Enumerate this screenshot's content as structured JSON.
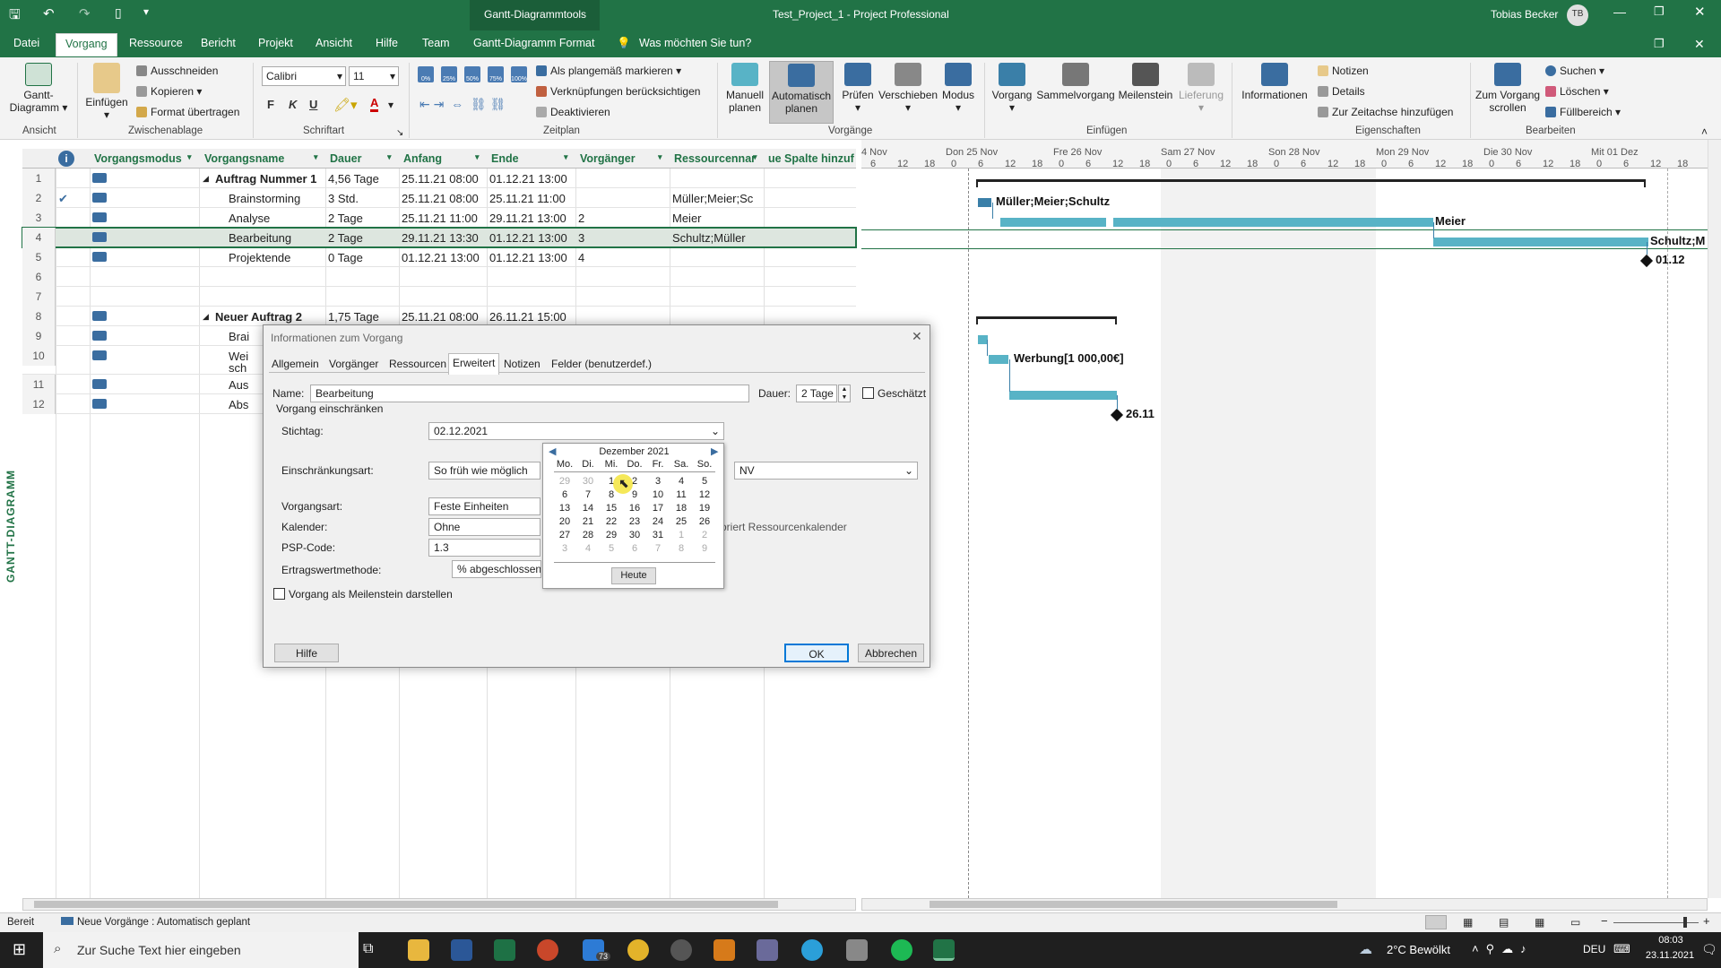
{
  "window": {
    "context_tab": "Gantt-Diagrammtools",
    "title": "Test_Project_1  -  Project Professional",
    "user": "Tobias Becker",
    "user_initials": "TB"
  },
  "menu": [
    "Datei",
    "Vorgang",
    "Ressource",
    "Bericht",
    "Projekt",
    "Ansicht",
    "Hilfe",
    "Team",
    "Gantt-Diagramm Format"
  ],
  "menu_active": "Vorgang",
  "tell_me": "Was möchten Sie tun?",
  "ribbon": {
    "ansicht": {
      "btn": "Gantt-",
      "btn2": "Diagramm",
      "label": "Ansicht"
    },
    "zwischenablage": {
      "paste": "Einfügen",
      "cut": "Ausschneiden",
      "copy": "Kopieren",
      "format": "Format übertragen",
      "label": "Zwischenablage"
    },
    "schrift": {
      "font": "Calibri",
      "size": "11",
      "bold": "F",
      "italic": "K",
      "underline": "U",
      "label": "Schriftart"
    },
    "zeitplan": {
      "mark": "Als plangemäß markieren",
      "links": "Verknüpfungen berücksichtigen",
      "deact": "Deaktivieren",
      "pct": [
        "0%",
        "25%",
        "50%",
        "75%",
        "100%"
      ],
      "label": "Zeitplan"
    },
    "vorgaenge": {
      "manual1": "Manuell",
      "manual2": "planen",
      "auto1": "Automatisch",
      "auto2": "planen",
      "check": "Prüfen",
      "move": "Verschieben",
      "mode": "Modus",
      "label": "Vorgänge"
    },
    "einfuegen": {
      "task": "Vorgang",
      "summary": "Sammelvorgang",
      "milestone": "Meilenstein",
      "delivery": "Lieferung",
      "label": "Einfügen"
    },
    "eigenschaften": {
      "info": "Informationen",
      "notes": "Notizen",
      "details": "Details",
      "timeline": "Zur Zeitachse hinzufügen",
      "label": "Eigenschaften"
    },
    "bearbeiten": {
      "scroll1": "Zum Vorgang",
      "scroll2": "scrollen",
      "search": "Suchen",
      "delete": "Löschen",
      "fill": "Füllbereich",
      "label": "Bearbeiten"
    }
  },
  "columns": [
    "Vorgangsmodus",
    "Vorgangsname",
    "Dauer",
    "Anfang",
    "Ende",
    "Vorgänger",
    "Ressourcennar",
    "ue Spalte hinzufü"
  ],
  "rows": [
    {
      "id": "1",
      "check": "",
      "name": "Auftrag Nummer 1",
      "dur": "4,56 Tage",
      "start": "25.11.21 08:00",
      "end": "01.12.21 13:00",
      "pred": "",
      "res": "",
      "summary": true,
      "mode": true
    },
    {
      "id": "2",
      "check": "✔",
      "name": "Brainstorming",
      "dur": "3 Std.",
      "start": "25.11.21 08:00",
      "end": "25.11.21 11:00",
      "pred": "",
      "res": "Müller;Meier;Sc",
      "summary": false,
      "mode": true
    },
    {
      "id": "3",
      "check": "",
      "name": "Analyse",
      "dur": "2 Tage",
      "start": "25.11.21 11:00",
      "end": "29.11.21 13:00",
      "pred": "2",
      "res": "Meier",
      "summary": false,
      "mode": true
    },
    {
      "id": "4",
      "check": "",
      "name": "Bearbeitung",
      "dur": "2 Tage",
      "start": "29.11.21 13:30",
      "end": "01.12.21 13:00",
      "pred": "3",
      "res": "Schultz;Müller",
      "summary": false,
      "mode": true
    },
    {
      "id": "5",
      "check": "",
      "name": "Projektende",
      "dur": "0 Tage",
      "start": "01.12.21 13:00",
      "end": "01.12.21 13:00",
      "pred": "4",
      "res": "",
      "summary": false,
      "mode": true
    },
    {
      "id": "6",
      "check": "",
      "name": "",
      "dur": "",
      "start": "",
      "end": "",
      "pred": "",
      "res": "",
      "summary": false,
      "mode": false
    },
    {
      "id": "7",
      "check": "",
      "name": "",
      "dur": "",
      "start": "",
      "end": "",
      "pred": "",
      "res": "",
      "summary": false,
      "mode": false
    },
    {
      "id": "8",
      "check": "",
      "name": "Neuer Auftrag 2",
      "dur": "1,75 Tage",
      "start": "25.11.21 08:00",
      "end": "26.11.21 15:00",
      "pred": "",
      "res": "",
      "summary": true,
      "mode": true
    },
    {
      "id": "9",
      "check": "",
      "name": "Brai",
      "dur": "",
      "start": "",
      "end": "",
      "pred": "",
      "res": "",
      "summary": false,
      "mode": true
    },
    {
      "id": "10",
      "check": "",
      "name": "Wei",
      "name2": "sch",
      "dur": "",
      "start": "",
      "end": "",
      "pred": "",
      "res": "",
      "summary": false,
      "mode": true
    },
    {
      "id": "11",
      "check": "",
      "name": "Aus",
      "dur": "",
      "start": "",
      "end": "",
      "pred": "",
      "res": "",
      "summary": false,
      "mode": true
    },
    {
      "id": "12",
      "check": "",
      "name": "Abs",
      "dur": "",
      "start": "",
      "end": "",
      "pred": "",
      "res": "",
      "summary": false,
      "mode": true
    }
  ],
  "side_label": "GANTT-DIAGRAMM",
  "gantt": {
    "days": [
      "4 Nov",
      "Don 25 Nov",
      "Fre 26 Nov",
      "Sam 27 Nov",
      "Son 28 Nov",
      "Mon 29 Nov",
      "Die 30 Nov",
      "Mit 01 Dez"
    ],
    "hours": [
      "6",
      "12",
      "18",
      "0",
      "6",
      "12",
      "18",
      "0",
      "6",
      "12",
      "18",
      "0",
      "6",
      "12",
      "18",
      "0",
      "6",
      "12",
      "18",
      "0",
      "6",
      "12",
      "18",
      "0",
      "6",
      "12",
      "18",
      "0",
      "6",
      "12",
      "18"
    ],
    "labels": {
      "brainstorm": "Müller;Meier;Schultz",
      "analyse": "Meier",
      "bearbeitung": "Schultz;M",
      "ende": "01.12",
      "werbung": "Werbung[1 000,00€]",
      "ende2": "26.11"
    }
  },
  "dialog": {
    "title": "Informationen zum Vorgang",
    "tabs": [
      "Allgemein",
      "Vorgänger",
      "Ressourcen",
      "Erweitert",
      "Notizen",
      "Felder (benutzerdef.)"
    ],
    "active_tab": "Erweitert",
    "name_label": "Name:",
    "name_value": "Bearbeitung",
    "dauer_label": "Dauer:",
    "dauer_value": "2 Tage",
    "estimated": "Geschätzt",
    "constrain_group": "Vorgang einschränken",
    "deadline_label": "Stichtag:",
    "deadline_value": "02.12.2021",
    "constraint_label": "Einschränkungsart:",
    "constraint_value": "So früh wie möglich",
    "constraint_date": "NV",
    "tasktype_label": "Vorgangsart:",
    "tasktype_value": "Feste Einheiten",
    "calendar_label": "Kalender:",
    "calendar_value": "Ohne",
    "calendar_note": "oriert Ressourcenkalender",
    "wbs_label": "PSP-Code:",
    "wbs_value": "1.3",
    "ev_label": "Ertragswertmethode:",
    "ev_value": "% abgeschlossen",
    "milestone": "Vorgang als Meilenstein darstellen",
    "help": "Hilfe",
    "ok": "OK",
    "cancel": "Abbrechen"
  },
  "calendar": {
    "month": "Dezember 2021",
    "weekdays": [
      "Mo.",
      "Di.",
      "Mi.",
      "Do.",
      "Fr.",
      "Sa.",
      "So."
    ],
    "weeks": [
      [
        "29",
        "30",
        "1",
        "2",
        "3",
        "4",
        "5"
      ],
      [
        "6",
        "7",
        "8",
        "9",
        "10",
        "11",
        "12"
      ],
      [
        "13",
        "14",
        "15",
        "16",
        "17",
        "18",
        "19"
      ],
      [
        "20",
        "21",
        "22",
        "23",
        "24",
        "25",
        "26"
      ],
      [
        "27",
        "28",
        "29",
        "30",
        "31",
        "1",
        "2"
      ],
      [
        "3",
        "4",
        "5",
        "6",
        "7",
        "8",
        "9"
      ]
    ],
    "today": "Heute"
  },
  "status": {
    "ready": "Bereit",
    "mode": "Neue Vorgänge : Automatisch geplant"
  },
  "taskbar": {
    "search": "Zur Suche Text hier eingeben",
    "weather": "2°C  Bewölkt",
    "lang": "DEU",
    "time": "08:03",
    "date": "23.11.2021",
    "badge": "73"
  },
  "colors": {
    "accent": "#217346",
    "bar": "#58b3c6"
  }
}
